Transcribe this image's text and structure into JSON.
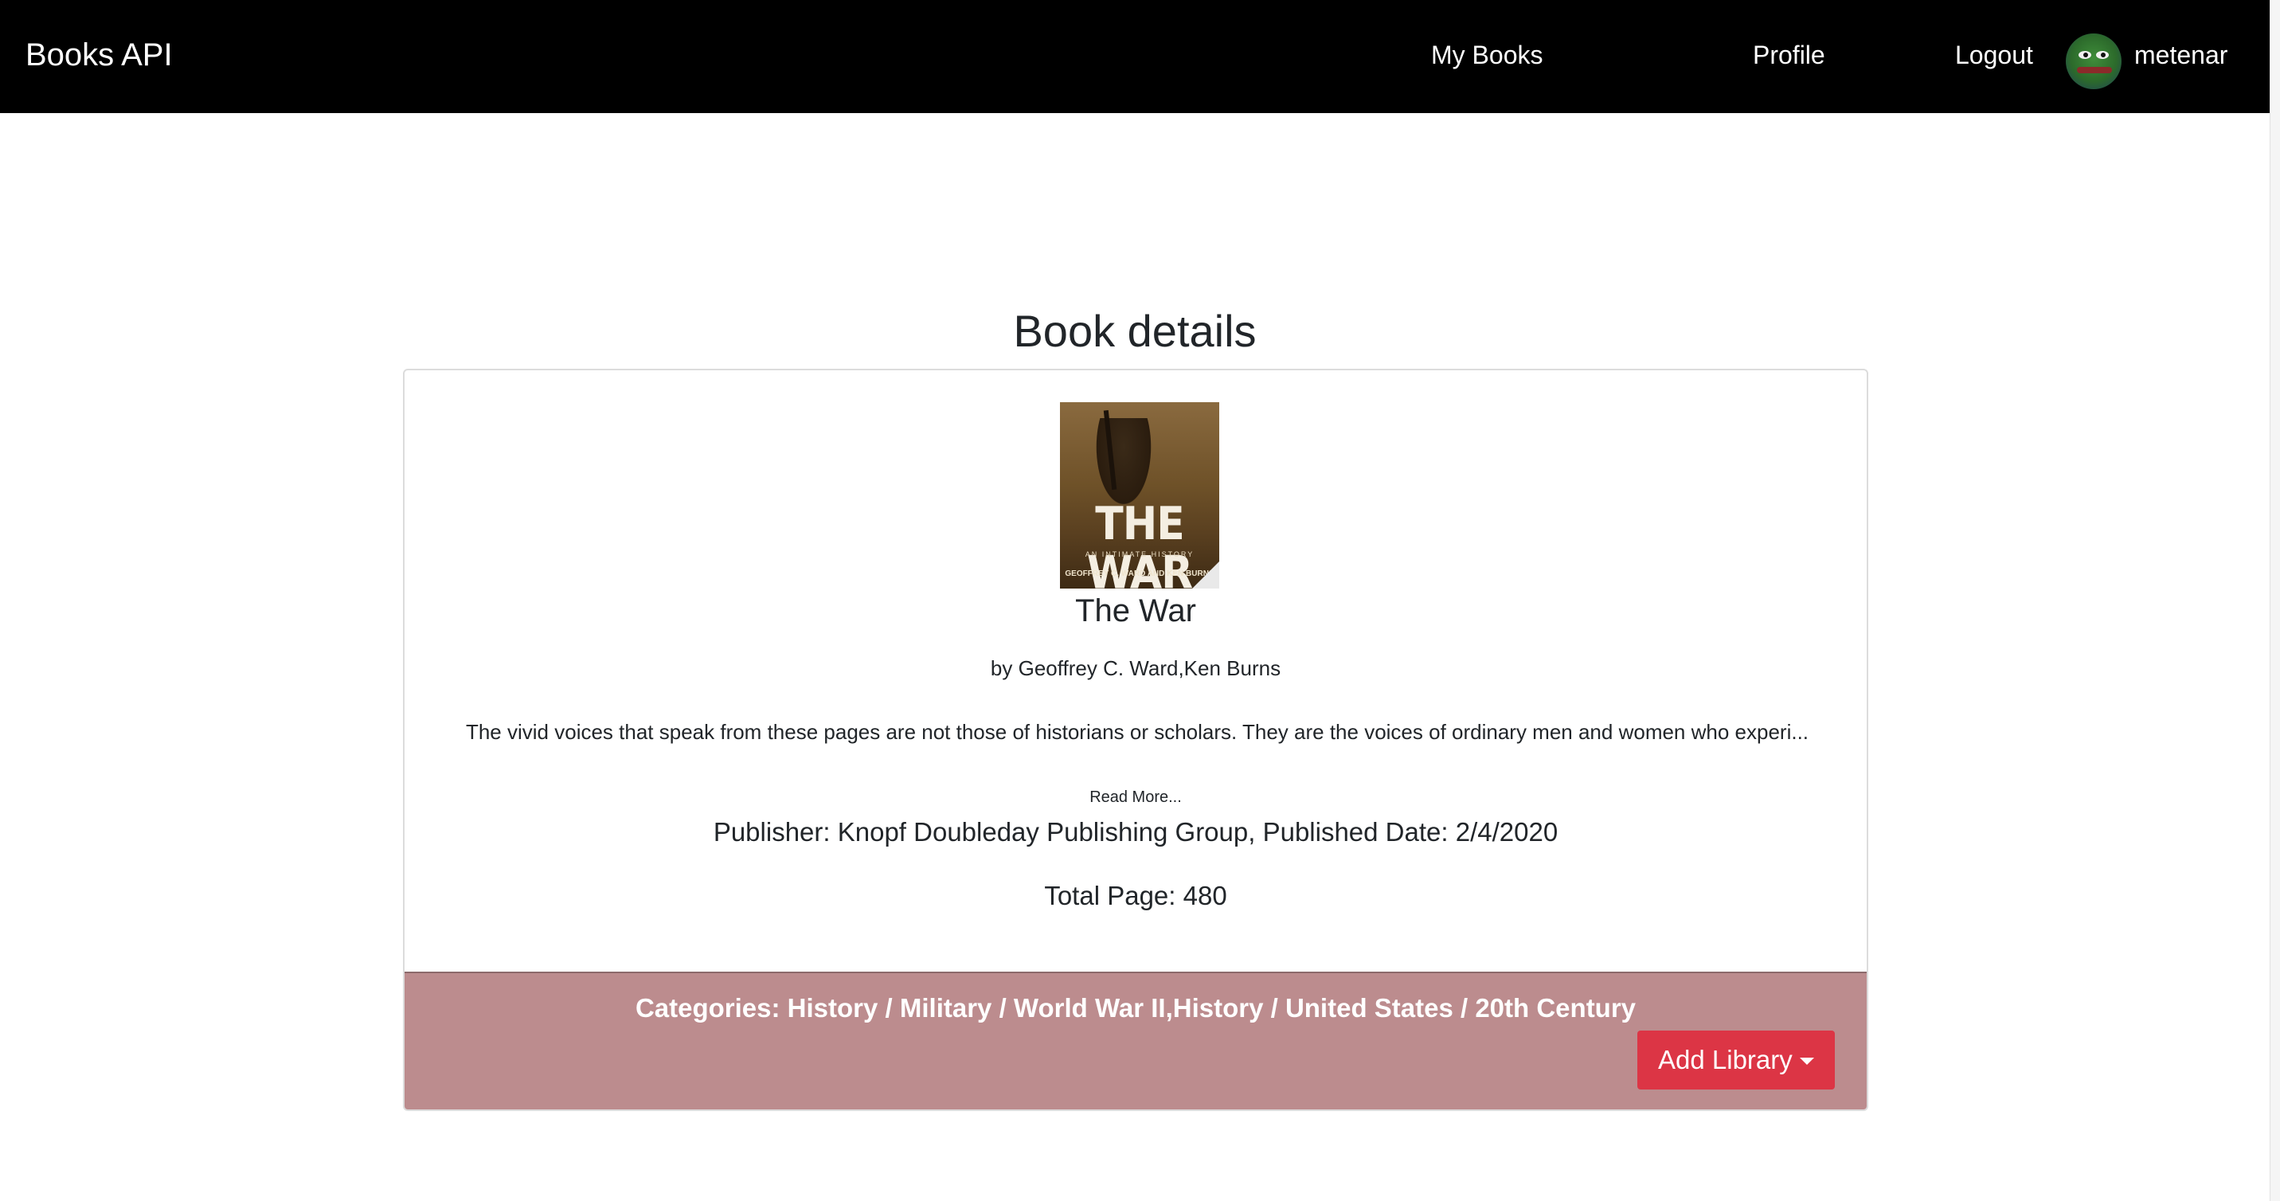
{
  "navbar": {
    "brand": "Books API",
    "links": {
      "my_books": "My Books",
      "profile": "Profile",
      "logout": "Logout"
    },
    "user": {
      "username": "metenar",
      "avatar_icon": "frog-avatar"
    }
  },
  "page": {
    "title": "Book details"
  },
  "book": {
    "cover": {
      "title": "THE WAR",
      "subtitle": "AN INTIMATE HISTORY",
      "authors": "GEOFFREY C. WARD AND KEN BURNS"
    },
    "title": "The War",
    "authors": "by Geoffrey C. Ward,Ken Burns",
    "description": "The vivid voices that speak from these pages are not those of historians or scholars. They are the voices of ordinary men and women who experi...",
    "read_more": "Read More...",
    "publisher_line": "Publisher: Knopf Doubleday Publishing Group, Published Date: 2/4/2020",
    "total_page_line": "Total Page: 480"
  },
  "footer": {
    "categories": "Categories: History / Military / World War II,History / United States / 20th Century",
    "add_library_label": "Add Library"
  },
  "colors": {
    "navbar_bg": "#000000",
    "footer_bg": "#bc8c8e",
    "button_bg": "#dc3545"
  }
}
